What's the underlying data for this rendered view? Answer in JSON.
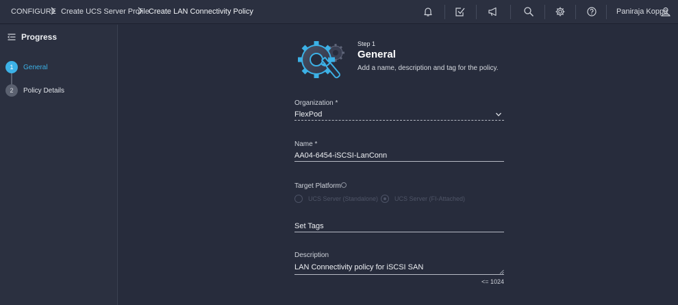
{
  "breadcrumb": {
    "items": [
      "CONFIGURE",
      "Create UCS Server Profile",
      "Create LAN Connectivity Policy"
    ]
  },
  "header": {
    "user_name": "Paniraja Koppa",
    "icons": [
      "bell-icon",
      "tasks-icon",
      "megaphone-icon",
      "search-icon",
      "gear-icon",
      "help-icon",
      "user-icon"
    ]
  },
  "sidebar": {
    "title": "Progress",
    "steps": [
      {
        "number": "1",
        "label": "General",
        "active": true
      },
      {
        "number": "2",
        "label": "Policy Details",
        "active": false
      }
    ]
  },
  "step": {
    "number_label": "Step 1",
    "title": "General",
    "description": "Add a name, description and tag for the policy."
  },
  "form": {
    "organization": {
      "label": "Organization *",
      "value": "FlexPod"
    },
    "name": {
      "label": "Name *",
      "value": "AA04-6454-iSCSI-LanConn"
    },
    "target_platform": {
      "label": "Target Platform",
      "options": [
        "UCS Server (Standalone)",
        "UCS Server (FI-Attached)"
      ],
      "selected": "UCS Server (FI-Attached)"
    },
    "tags": {
      "label": "Set Tags"
    },
    "description": {
      "label": "Description",
      "value": "LAN Connectivity policy for iSCSI SAN",
      "limit": "<= 1024"
    }
  },
  "colors": {
    "background": "#272c3c",
    "bar": "#2b3040",
    "accent": "#3cb1e6"
  }
}
